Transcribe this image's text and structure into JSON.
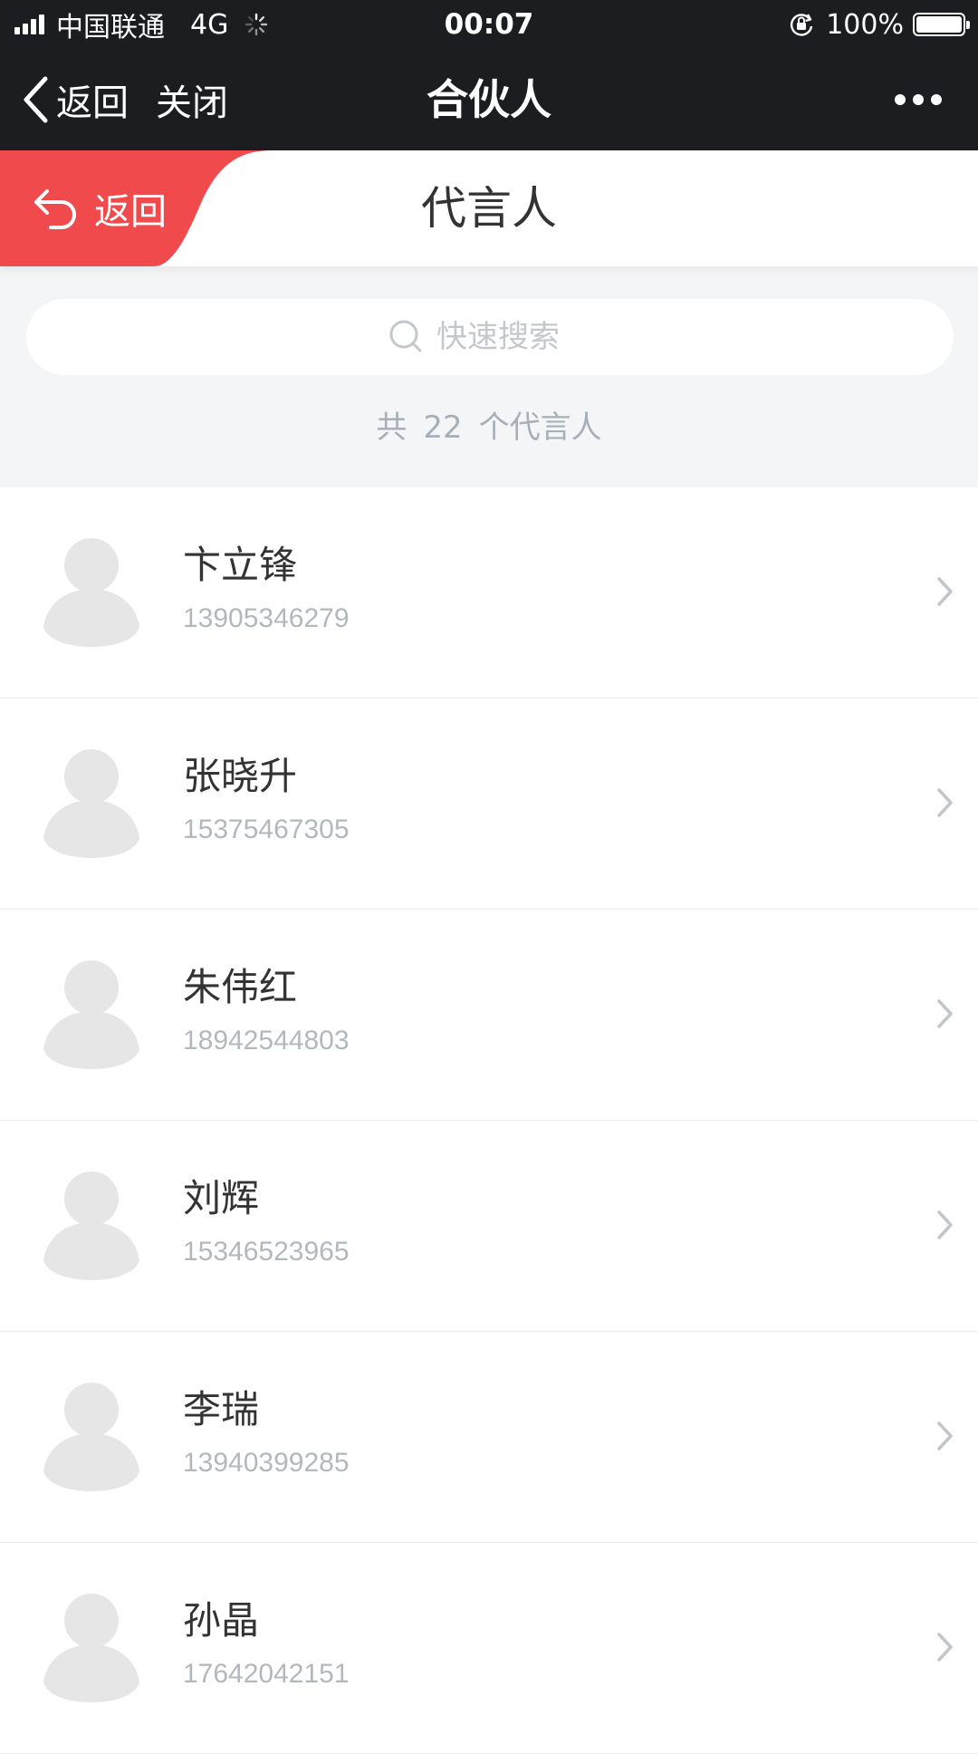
{
  "status_bar": {
    "carrier": "中国联通",
    "network": "4G",
    "time": "00:07",
    "battery_percent": "100%",
    "battery_level": 1.0
  },
  "nav_bar": {
    "back_label": "返回",
    "close_label": "关闭",
    "title": "合伙人"
  },
  "header": {
    "back_label": "返回",
    "title": "代言人",
    "accent_color": "#f04a4d"
  },
  "search": {
    "placeholder": "快速搜索"
  },
  "summary": {
    "prefix": "共",
    "count": "22",
    "suffix": "个代言人"
  },
  "spokespersons": [
    {
      "name": "卞立锋",
      "phone": "13905346279"
    },
    {
      "name": "张晓升",
      "phone": "15375467305"
    },
    {
      "name": "朱伟红",
      "phone": "18942544803"
    },
    {
      "name": "刘辉",
      "phone": "15346523965"
    },
    {
      "name": "李瑞",
      "phone": "13940399285"
    },
    {
      "name": "孙晶",
      "phone": "17642042151"
    }
  ]
}
